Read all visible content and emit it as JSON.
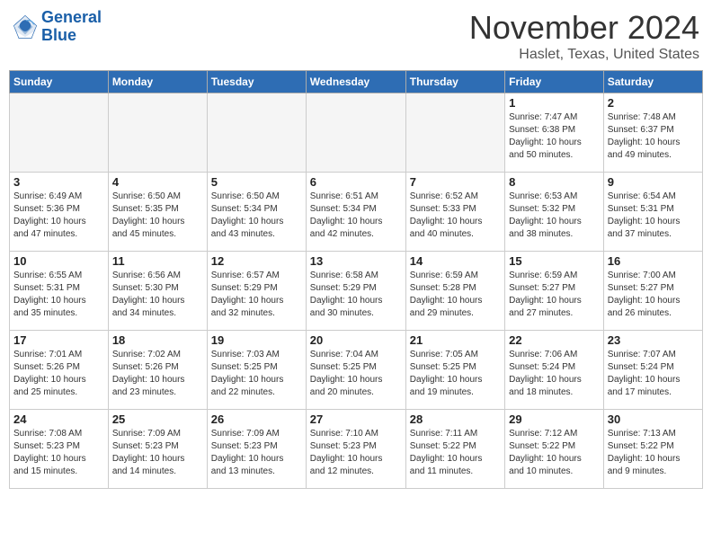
{
  "header": {
    "logo_line1": "General",
    "logo_line2": "Blue",
    "month": "November 2024",
    "location": "Haslet, Texas, United States"
  },
  "weekdays": [
    "Sunday",
    "Monday",
    "Tuesday",
    "Wednesday",
    "Thursday",
    "Friday",
    "Saturday"
  ],
  "weeks": [
    [
      {
        "day": "",
        "info": ""
      },
      {
        "day": "",
        "info": ""
      },
      {
        "day": "",
        "info": ""
      },
      {
        "day": "",
        "info": ""
      },
      {
        "day": "",
        "info": ""
      },
      {
        "day": "1",
        "info": "Sunrise: 7:47 AM\nSunset: 6:38 PM\nDaylight: 10 hours\nand 50 minutes."
      },
      {
        "day": "2",
        "info": "Sunrise: 7:48 AM\nSunset: 6:37 PM\nDaylight: 10 hours\nand 49 minutes."
      }
    ],
    [
      {
        "day": "3",
        "info": "Sunrise: 6:49 AM\nSunset: 5:36 PM\nDaylight: 10 hours\nand 47 minutes."
      },
      {
        "day": "4",
        "info": "Sunrise: 6:50 AM\nSunset: 5:35 PM\nDaylight: 10 hours\nand 45 minutes."
      },
      {
        "day": "5",
        "info": "Sunrise: 6:50 AM\nSunset: 5:34 PM\nDaylight: 10 hours\nand 43 minutes."
      },
      {
        "day": "6",
        "info": "Sunrise: 6:51 AM\nSunset: 5:34 PM\nDaylight: 10 hours\nand 42 minutes."
      },
      {
        "day": "7",
        "info": "Sunrise: 6:52 AM\nSunset: 5:33 PM\nDaylight: 10 hours\nand 40 minutes."
      },
      {
        "day": "8",
        "info": "Sunrise: 6:53 AM\nSunset: 5:32 PM\nDaylight: 10 hours\nand 38 minutes."
      },
      {
        "day": "9",
        "info": "Sunrise: 6:54 AM\nSunset: 5:31 PM\nDaylight: 10 hours\nand 37 minutes."
      }
    ],
    [
      {
        "day": "10",
        "info": "Sunrise: 6:55 AM\nSunset: 5:31 PM\nDaylight: 10 hours\nand 35 minutes."
      },
      {
        "day": "11",
        "info": "Sunrise: 6:56 AM\nSunset: 5:30 PM\nDaylight: 10 hours\nand 34 minutes."
      },
      {
        "day": "12",
        "info": "Sunrise: 6:57 AM\nSunset: 5:29 PM\nDaylight: 10 hours\nand 32 minutes."
      },
      {
        "day": "13",
        "info": "Sunrise: 6:58 AM\nSunset: 5:29 PM\nDaylight: 10 hours\nand 30 minutes."
      },
      {
        "day": "14",
        "info": "Sunrise: 6:59 AM\nSunset: 5:28 PM\nDaylight: 10 hours\nand 29 minutes."
      },
      {
        "day": "15",
        "info": "Sunrise: 6:59 AM\nSunset: 5:27 PM\nDaylight: 10 hours\nand 27 minutes."
      },
      {
        "day": "16",
        "info": "Sunrise: 7:00 AM\nSunset: 5:27 PM\nDaylight: 10 hours\nand 26 minutes."
      }
    ],
    [
      {
        "day": "17",
        "info": "Sunrise: 7:01 AM\nSunset: 5:26 PM\nDaylight: 10 hours\nand 25 minutes."
      },
      {
        "day": "18",
        "info": "Sunrise: 7:02 AM\nSunset: 5:26 PM\nDaylight: 10 hours\nand 23 minutes."
      },
      {
        "day": "19",
        "info": "Sunrise: 7:03 AM\nSunset: 5:25 PM\nDaylight: 10 hours\nand 22 minutes."
      },
      {
        "day": "20",
        "info": "Sunrise: 7:04 AM\nSunset: 5:25 PM\nDaylight: 10 hours\nand 20 minutes."
      },
      {
        "day": "21",
        "info": "Sunrise: 7:05 AM\nSunset: 5:25 PM\nDaylight: 10 hours\nand 19 minutes."
      },
      {
        "day": "22",
        "info": "Sunrise: 7:06 AM\nSunset: 5:24 PM\nDaylight: 10 hours\nand 18 minutes."
      },
      {
        "day": "23",
        "info": "Sunrise: 7:07 AM\nSunset: 5:24 PM\nDaylight: 10 hours\nand 17 minutes."
      }
    ],
    [
      {
        "day": "24",
        "info": "Sunrise: 7:08 AM\nSunset: 5:23 PM\nDaylight: 10 hours\nand 15 minutes."
      },
      {
        "day": "25",
        "info": "Sunrise: 7:09 AM\nSunset: 5:23 PM\nDaylight: 10 hours\nand 14 minutes."
      },
      {
        "day": "26",
        "info": "Sunrise: 7:09 AM\nSunset: 5:23 PM\nDaylight: 10 hours\nand 13 minutes."
      },
      {
        "day": "27",
        "info": "Sunrise: 7:10 AM\nSunset: 5:23 PM\nDaylight: 10 hours\nand 12 minutes."
      },
      {
        "day": "28",
        "info": "Sunrise: 7:11 AM\nSunset: 5:22 PM\nDaylight: 10 hours\nand 11 minutes."
      },
      {
        "day": "29",
        "info": "Sunrise: 7:12 AM\nSunset: 5:22 PM\nDaylight: 10 hours\nand 10 minutes."
      },
      {
        "day": "30",
        "info": "Sunrise: 7:13 AM\nSunset: 5:22 PM\nDaylight: 10 hours\nand 9 minutes."
      }
    ]
  ]
}
